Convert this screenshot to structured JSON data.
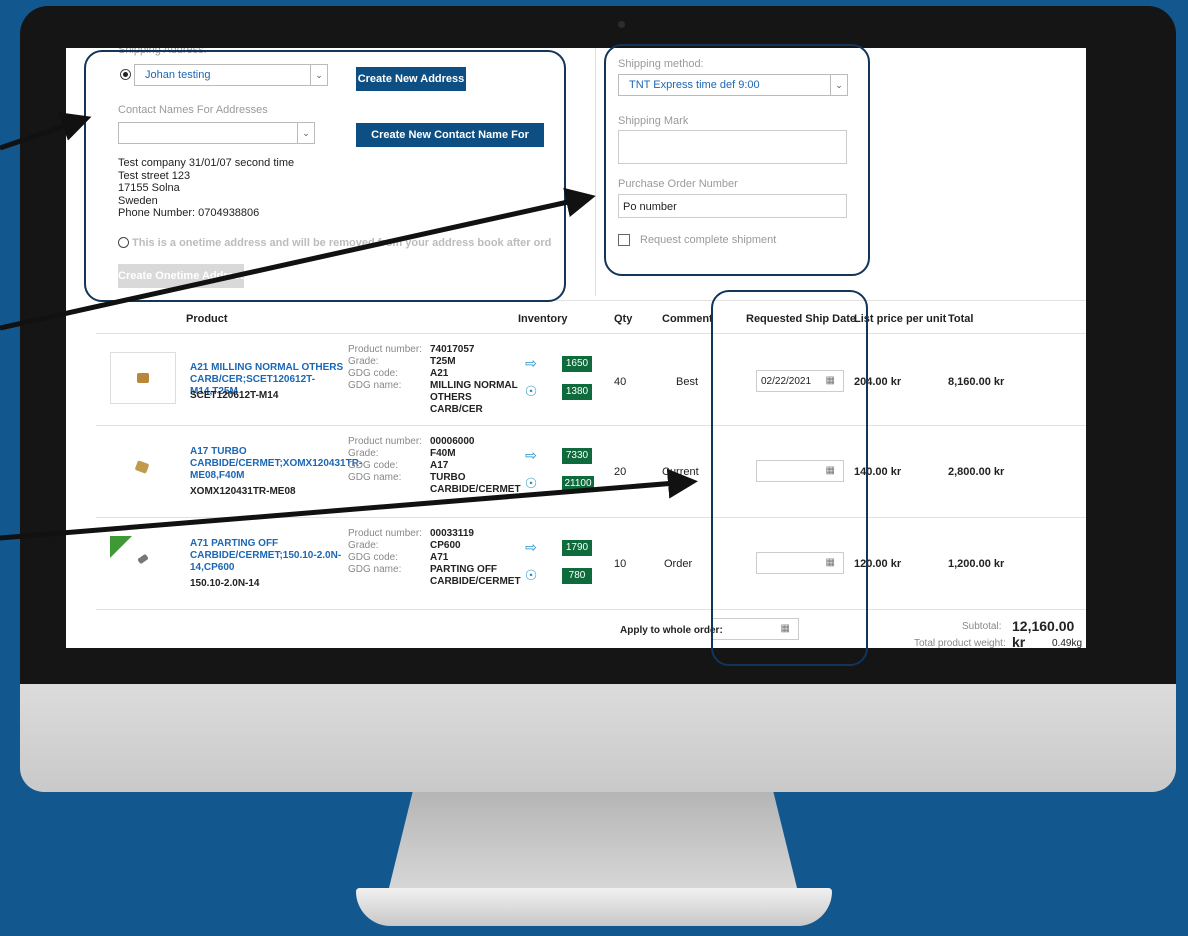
{
  "shipping_address": {
    "section_label": "Shipping Address:",
    "selected": "Johan testing",
    "create_address_btn": "Create New Address",
    "contact_label": "Contact Names For Addresses",
    "contact_selected": "",
    "create_contact_btn": "Create New Contact Name For Address",
    "address_lines": [
      "Test company 31/01/07 second time",
      "Test street 123",
      "17155 Solna",
      "Sweden",
      "Phone Number: 0704938806"
    ],
    "onetime_text": "This is a onetime address and will be removed from your address book after order submit",
    "onetime_btn": "Create Onetime Address"
  },
  "shipping": {
    "method_label": "Shipping method:",
    "method_selected": "TNT Express time def 9:00",
    "mark_label": "Shipping Mark",
    "mark_value": "",
    "po_label": "Purchase Order Number",
    "po_value": "Po number",
    "complete_label": "Request complete shipment"
  },
  "table": {
    "headers": {
      "product": "Product",
      "inventory": "Inventory",
      "qty": "Qty",
      "comment": "Comment",
      "ship_date": "Requested Ship Date",
      "list_price": "List price per unit",
      "total": "Total"
    },
    "detail_labels": {
      "product_number": "Product number:",
      "grade": "Grade:",
      "gdg_code": "GDG code:",
      "gdg_name": "GDG name:"
    },
    "rows": [
      {
        "name": "A21 MILLING NORMAL OTHERS CARB/CER;SCET120612T-M14,T25M",
        "code": "SCET120612T-M14",
        "product_number": "74017057",
        "grade": "T25M",
        "gdg_code": "A21",
        "gdg_name": "MILLING NORMAL OTHERS CARB/CER",
        "stock1": "1650",
        "stock2": "1380",
        "qty": "40",
        "comment": "Best",
        "ship_date": "02/22/2021",
        "list_price": "204.00 kr",
        "total": "8,160.00 kr"
      },
      {
        "name": "A17 TURBO CARBIDE/CERMET;XOMX120431TR-ME08,F40M",
        "code": "XOMX120431TR-ME08",
        "product_number": "00006000",
        "grade": "F40M",
        "gdg_code": "A17",
        "gdg_name": "TURBO CARBIDE/CERMET",
        "stock1": "7330",
        "stock2": "21100",
        "qty": "20",
        "comment": "Current",
        "ship_date": "",
        "list_price": "140.00 kr",
        "total": "2,800.00 kr"
      },
      {
        "name": "A71 PARTING OFF CARBIDE/CERMET;150.10-2.0N-14,CP600",
        "code": "150.10-2.0N-14",
        "product_number": "00033119",
        "grade": "CP600",
        "gdg_code": "A71",
        "gdg_name": "PARTING OFF CARBIDE/CERMET",
        "stock1": "1790",
        "stock2": "780",
        "qty": "10",
        "comment": "Order",
        "ship_date": "",
        "list_price": "120.00 kr",
        "total": "1,200.00 kr"
      }
    ]
  },
  "footer": {
    "apply_label": "Apply to whole order:",
    "subtotal_label": "Subtotal:",
    "subtotal_value": "12,160.00 kr",
    "weight_label": "Total product weight:",
    "weight_value": "0.49kg"
  },
  "colors": {
    "background": "#12588f",
    "button": "#0e4f83",
    "link": "#1a67b5",
    "stock_badge": "#0f6b3c",
    "annotation": "#12355a"
  }
}
